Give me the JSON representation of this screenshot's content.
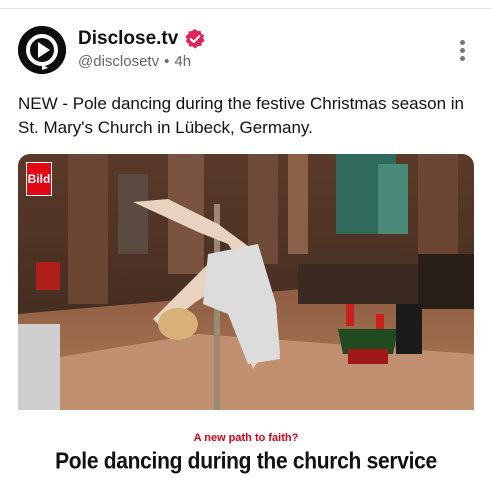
{
  "post": {
    "display_name": "Disclose.tv",
    "handle": "@disclosetv",
    "separator": "•",
    "time": "4h",
    "text": "NEW - Pole dancing during the festive Christmas season in St. Mary's Church in Lübeck, Germany."
  },
  "media": {
    "logo_text": "Bild",
    "kicker": "A new path to faith?",
    "headline": "Pole dancing during the church service"
  },
  "colors": {
    "verified_badge": "#e0245e",
    "kicker": "#d0021b",
    "bild_red": "#e30613"
  },
  "icons": {
    "avatar": "play-triangle-logo",
    "verified": "verified-badge-icon",
    "more": "more-options-icon"
  }
}
